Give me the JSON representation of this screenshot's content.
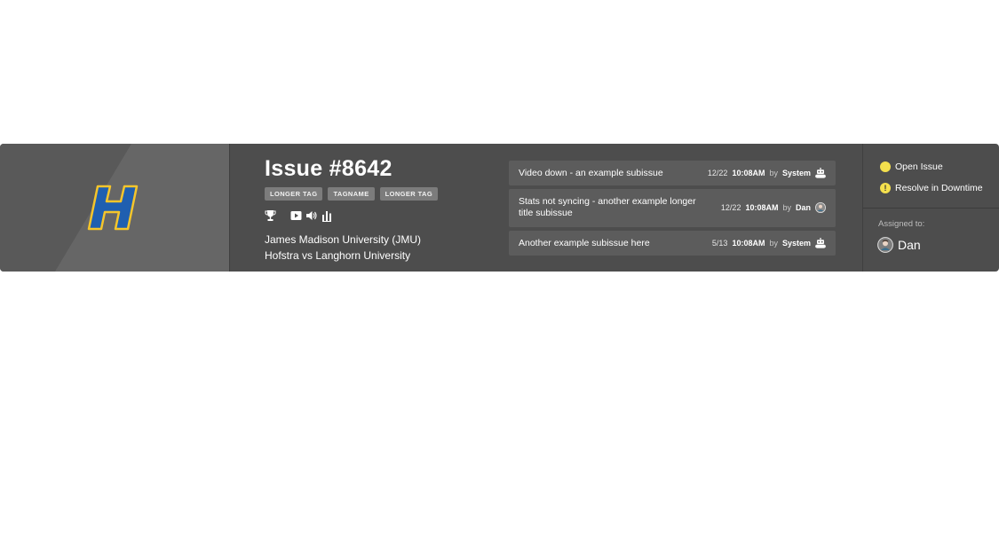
{
  "issue": {
    "title": "Issue #8642",
    "tags": [
      "LONGER TAG",
      "TAGNAME",
      "LONGER TAG"
    ],
    "icons": [
      "trophy-icon",
      "video-icon",
      "volume-icon",
      "stats-icon"
    ],
    "team_line1": "James Madison University (JMU)",
    "team_line2": "Hofstra vs Langhorn University",
    "logo_letter": "H"
  },
  "subissues": [
    {
      "title": "Video down - an example subissue",
      "date": "12/22",
      "time": "10:08AM",
      "by": "by",
      "who": "System",
      "who_icon": "robot-icon"
    },
    {
      "title": "Stats not syncing - another example longer title subissue",
      "date": "12/22",
      "time": "10:08AM",
      "by": "by",
      "who": "Dan",
      "who_icon": "avatar-icon"
    },
    {
      "title": "Another example subissue here",
      "date": "5/13",
      "time": "10:08AM",
      "by": "by",
      "who": "System",
      "who_icon": "robot-icon"
    }
  ],
  "status": {
    "open_label": "Open Issue",
    "resolve_label": "Resolve in Downtime",
    "accent": "#f4e04d"
  },
  "assignment": {
    "label": "Assigned to:",
    "name": "Dan"
  },
  "colors": {
    "card_bg": "#4d4d4d",
    "logo_panel_bg": "#595959",
    "subissue_bg": "#5c5c5c",
    "logo_blue": "#1f5fb0",
    "logo_gold": "#f5c52b"
  }
}
